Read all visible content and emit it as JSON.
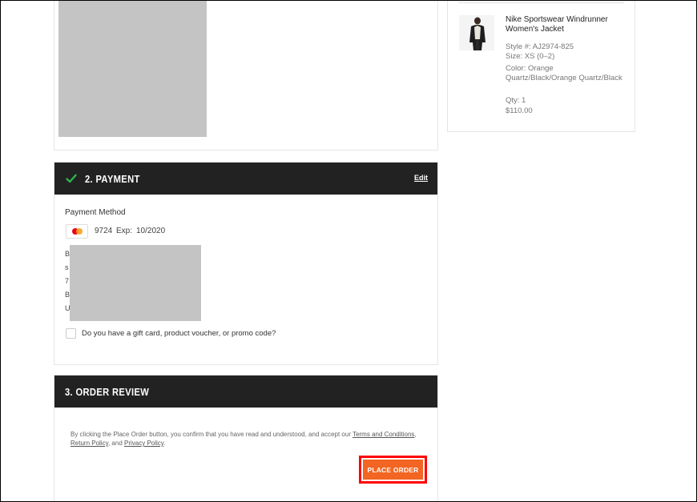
{
  "payment": {
    "step_title": "2. PAYMENT",
    "edit_label": "Edit",
    "method_label": "Payment Method",
    "card_brand": "mastercard-icon",
    "card_last4": "9724",
    "exp_label": "Exp:",
    "exp_value": "10/2020",
    "address_initials": [
      "B",
      "s",
      "7",
      "B",
      "U"
    ],
    "promo_label": "Do you have a gift card, product voucher, or promo code?"
  },
  "review": {
    "step_title": "3. ORDER REVIEW",
    "legal_prefix": "By clicking the Place Order button, you confirm that you have read and understood, and accept our ",
    "terms_label": "Terms and Conditions",
    "sep1": ", ",
    "return_label": "Return Policy",
    "sep2": ", and ",
    "privacy_label": "Privacy Policy",
    "legal_suffix": ".",
    "place_order_label": "PLACE ORDER"
  },
  "summary": {
    "product_name": "Nike Sportswear Windrunner Women's Jacket",
    "style": "Style #: AJ2974-825",
    "size": "Size: XS (0–2)",
    "color": "Color: Orange Quartz/Black/Orange Quartz/Black",
    "qty": "Qty: 1",
    "price": "$110.00"
  },
  "colors": {
    "header_bg": "#222222",
    "accent_check": "#2db34a",
    "place_order_bg": "#f26522",
    "highlight_box": "#ff0000"
  }
}
